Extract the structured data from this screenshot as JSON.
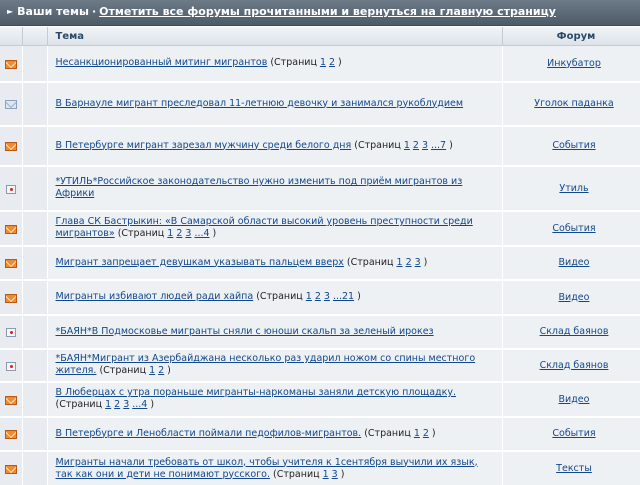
{
  "header": {
    "title": "Ваши темы",
    "separator": "·",
    "mark_read_link": "Отметить все форумы прочитанными и вернуться на главную страницу"
  },
  "table": {
    "col_topic": "Тема",
    "col_forum": "Форум"
  },
  "icons": {
    "new_posts": "envelope-icon",
    "read": "envelope-read-icon",
    "announcement": "announcement-icon"
  },
  "colors": {
    "header_bar": "#59676f",
    "link": "#12478c",
    "row_bg": "#eef1f4",
    "new_icon": "#f08a2b"
  },
  "topics": [
    {
      "icon": "new",
      "title": "Несанкционированный митинг мигрантов",
      "pages_prefix": "(Страниц",
      "pages": [
        "1",
        "2"
      ],
      "pages_suffix": ")",
      "forum": "Инкубатор"
    },
    {
      "icon": "read",
      "title": "В Барнауле мигрант преследовал 11-летнюю девочку и занимался рукоблудием",
      "pages_prefix": "",
      "pages": [],
      "pages_suffix": "",
      "forum": "Уголок паданка"
    },
    {
      "icon": "new",
      "title": "В Петербурге мигрант зарезал мужчину среди белого дня",
      "pages_prefix": "(Страниц",
      "pages": [
        "1",
        "2",
        "3",
        "...7"
      ],
      "pages_suffix": ")",
      "forum": "События"
    },
    {
      "icon": "announcement",
      "title": "*УТИЛЬ*Российское законодательство нужно изменить под приём мигрантов из Африки",
      "pages_prefix": "",
      "pages": [],
      "pages_suffix": "",
      "forum": "Утиль"
    },
    {
      "icon": "new",
      "title": "Глава СК Бастрыкин: «В Самарской области высокий уровень преступности среди мигрантов»",
      "pages_prefix": "(Страниц",
      "pages": [
        "1",
        "2",
        "3",
        "...4"
      ],
      "pages_suffix": ")",
      "forum": "События"
    },
    {
      "icon": "new",
      "title": "Мигрант запрещает девушкам указывать пальцем вверх",
      "pages_prefix": "(Страниц",
      "pages": [
        "1",
        "2",
        "3"
      ],
      "pages_suffix": ")",
      "forum": "Видео"
    },
    {
      "icon": "new",
      "title": "Мигранты избивают людей ради хайпа",
      "pages_prefix": "(Страниц",
      "pages": [
        "1",
        "2",
        "3",
        "...21"
      ],
      "pages_suffix": ")",
      "forum": "Видео"
    },
    {
      "icon": "announcement",
      "title": "*БАЯН*В Подмосковье мигранты сняли с юноши скальп за зеленый ирокез",
      "pages_prefix": "",
      "pages": [],
      "pages_suffix": "",
      "forum": "Склад баянов"
    },
    {
      "icon": "announcement",
      "title": "*БАЯН*Мигрант из Азербайджана несколько раз ударил ножом со спины местного жителя.",
      "pages_prefix": "(Страниц",
      "pages": [
        "1",
        "2"
      ],
      "pages_suffix": ")",
      "forum": "Склад баянов"
    },
    {
      "icon": "new",
      "title": "В Люберцах с утра пораньше мигранты-наркоманы заняли детскую площадку.",
      "pages_prefix": "(Страниц",
      "pages": [
        "1",
        "2",
        "3",
        "...4"
      ],
      "pages_suffix": ")",
      "forum": "Видео"
    },
    {
      "icon": "new",
      "title": "В Петербурге и Ленобласти поймали педофилов-мигрантов.",
      "pages_prefix": "(Страниц",
      "pages": [
        "1",
        "2"
      ],
      "pages_suffix": ")",
      "forum": "События"
    },
    {
      "icon": "new",
      "title": "Мигранты начали требовать от школ, чтобы учителя к 1сентября выучили их язык, так как они и дети не понимают русского.",
      "pages_prefix": "(Страниц",
      "pages": [
        "1",
        "3"
      ],
      "pages_suffix": ")",
      "forum": "Тексты"
    }
  ]
}
